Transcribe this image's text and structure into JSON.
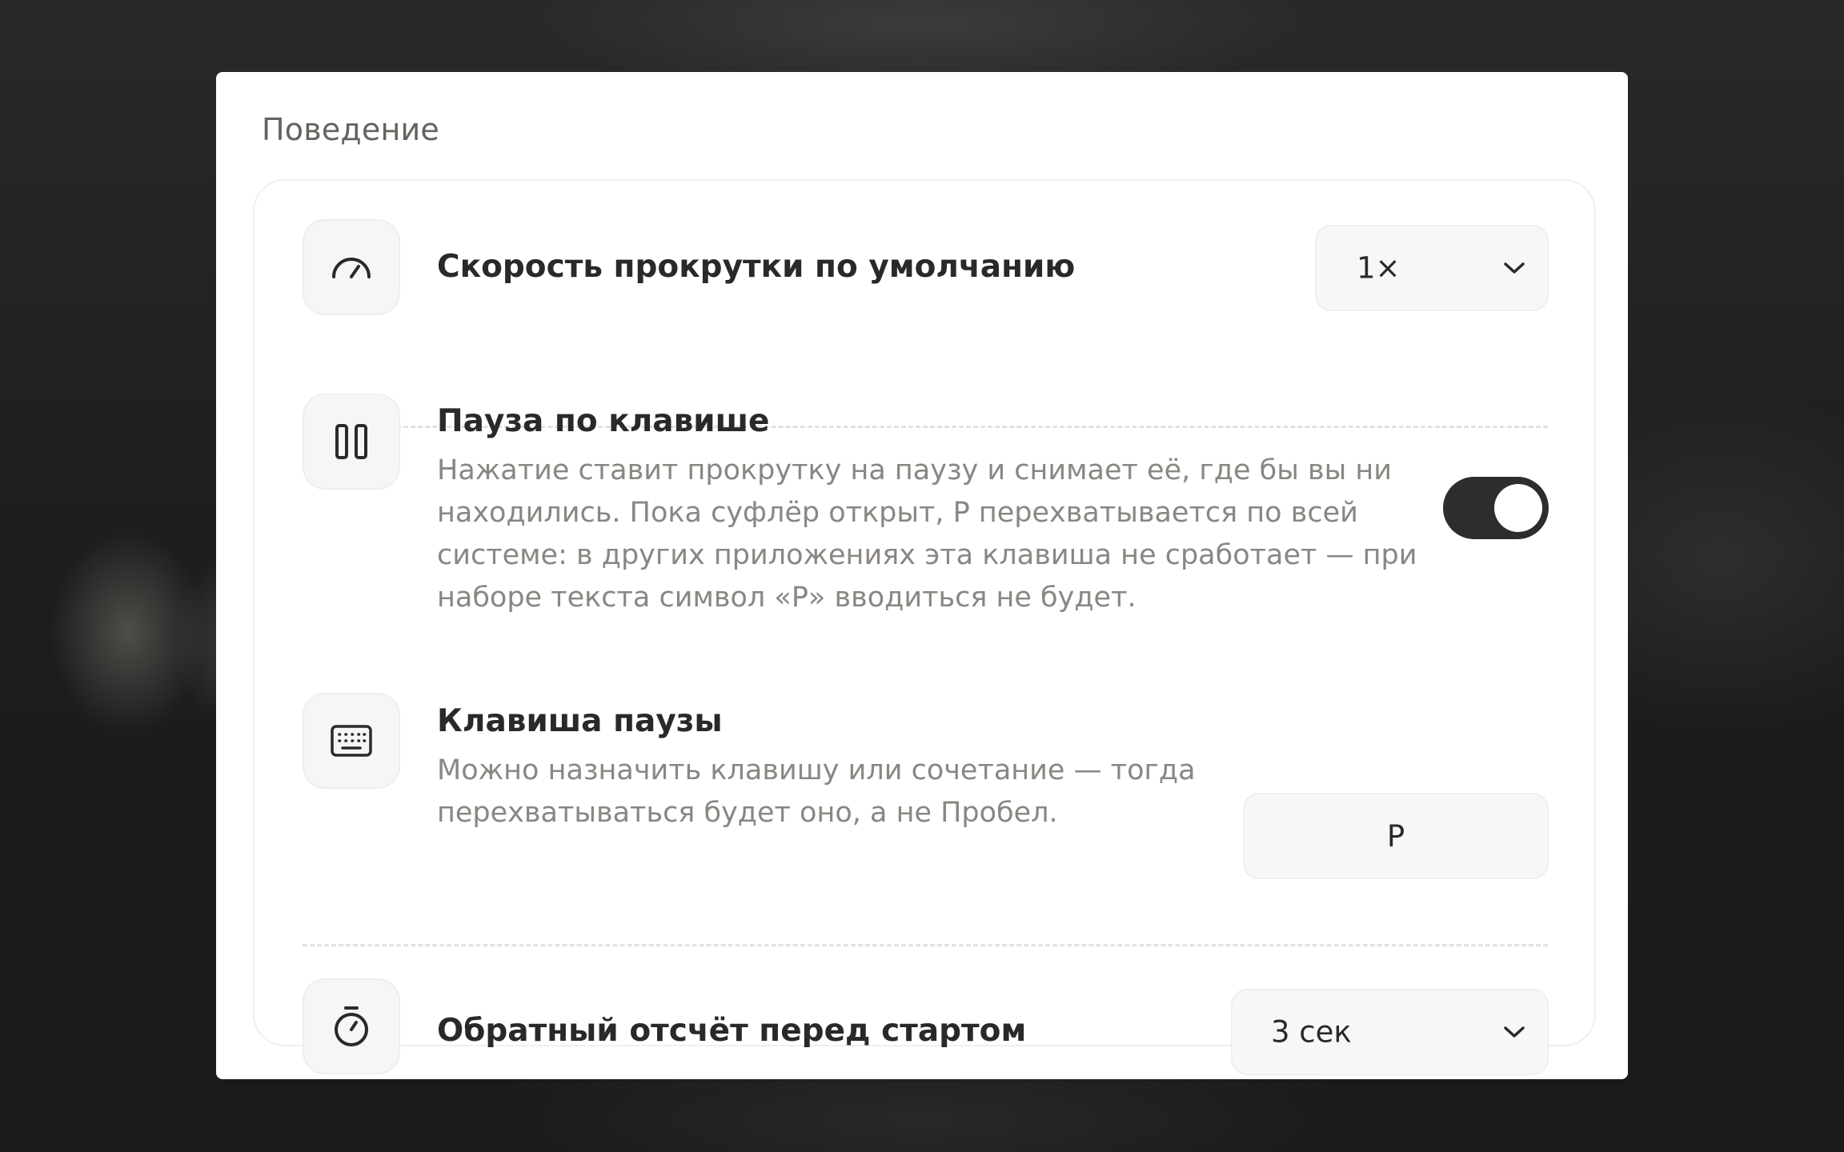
{
  "section": {
    "title": "Поведение"
  },
  "scroll_speed": {
    "icon": "gauge-icon",
    "title": "Скорость прокрутки по умолчанию",
    "value": "1×"
  },
  "pause_toggle": {
    "icon": "pause-icon",
    "title": "Пауза по клавише",
    "description_lines": [
      "Нажатие ставит прокрутку на паузу и снимает её, где бы вы ни",
      "находились. Пока суфлёр открыт, P перехватывается по всей",
      "системе: в других приложениях эта клавиша не сработает — при",
      "наборе текста символ «P» вводиться не будет."
    ],
    "enabled": true
  },
  "pause_key": {
    "icon": "keyboard-icon",
    "title": "Клавиша паузы",
    "description_lines": [
      "Можно назначить клавишу или сочетание — тогда",
      "перехватываться будет оно, а не Пробел."
    ],
    "value": "P"
  },
  "countdown": {
    "icon": "stopwatch-icon",
    "title": "Обратный отсчёт перед стартом",
    "value": "3 сек"
  },
  "colors": {
    "toggle_on": "#2e2d2b",
    "title_text": "#2b2927",
    "secondary_text": "#8a8682"
  }
}
